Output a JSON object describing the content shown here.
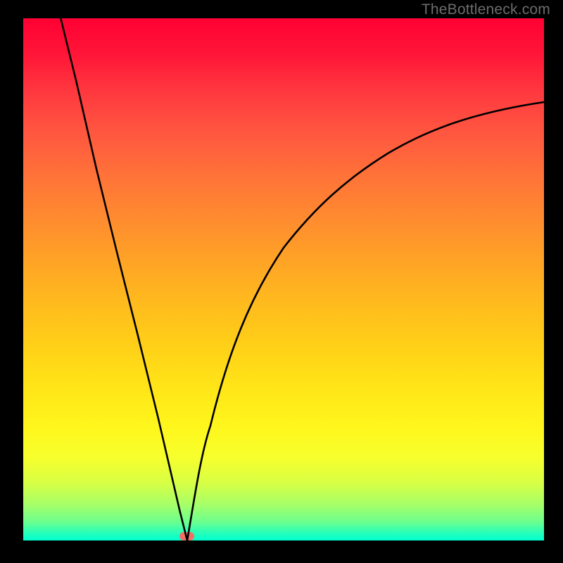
{
  "watermark": "TheBottleneck.com",
  "colors": {
    "frame": "#000000",
    "curve": "#000000",
    "marker": "#f07066"
  },
  "chart_data": {
    "type": "line",
    "title": "",
    "xlabel": "",
    "ylabel": "",
    "xlim": [
      0,
      100
    ],
    "ylim": [
      0,
      100
    ],
    "grid": false,
    "legend": false,
    "series": [
      {
        "name": "left-branch",
        "x": [
          7,
          10,
          14,
          18,
          22,
          26,
          30,
          31.5
        ],
        "y": [
          100,
          88,
          71,
          55,
          39,
          23,
          6,
          0
        ]
      },
      {
        "name": "right-branch",
        "x": [
          31.5,
          33,
          36,
          40,
          45,
          50,
          56,
          62,
          70,
          80,
          90,
          100
        ],
        "y": [
          0,
          8,
          22,
          36,
          48,
          56,
          63,
          68,
          73,
          78,
          81.5,
          84
        ]
      }
    ],
    "annotations": [
      {
        "name": "optimal-marker",
        "x": 31.5,
        "y": 0
      }
    ],
    "background_gradient": {
      "direction": "vertical",
      "stops": [
        {
          "pos": 0.0,
          "color": "#ff0033"
        },
        {
          "pos": 0.5,
          "color": "#ffb000"
        },
        {
          "pos": 0.8,
          "color": "#fff61c"
        },
        {
          "pos": 1.0,
          "color": "#00ffd0"
        }
      ]
    }
  }
}
